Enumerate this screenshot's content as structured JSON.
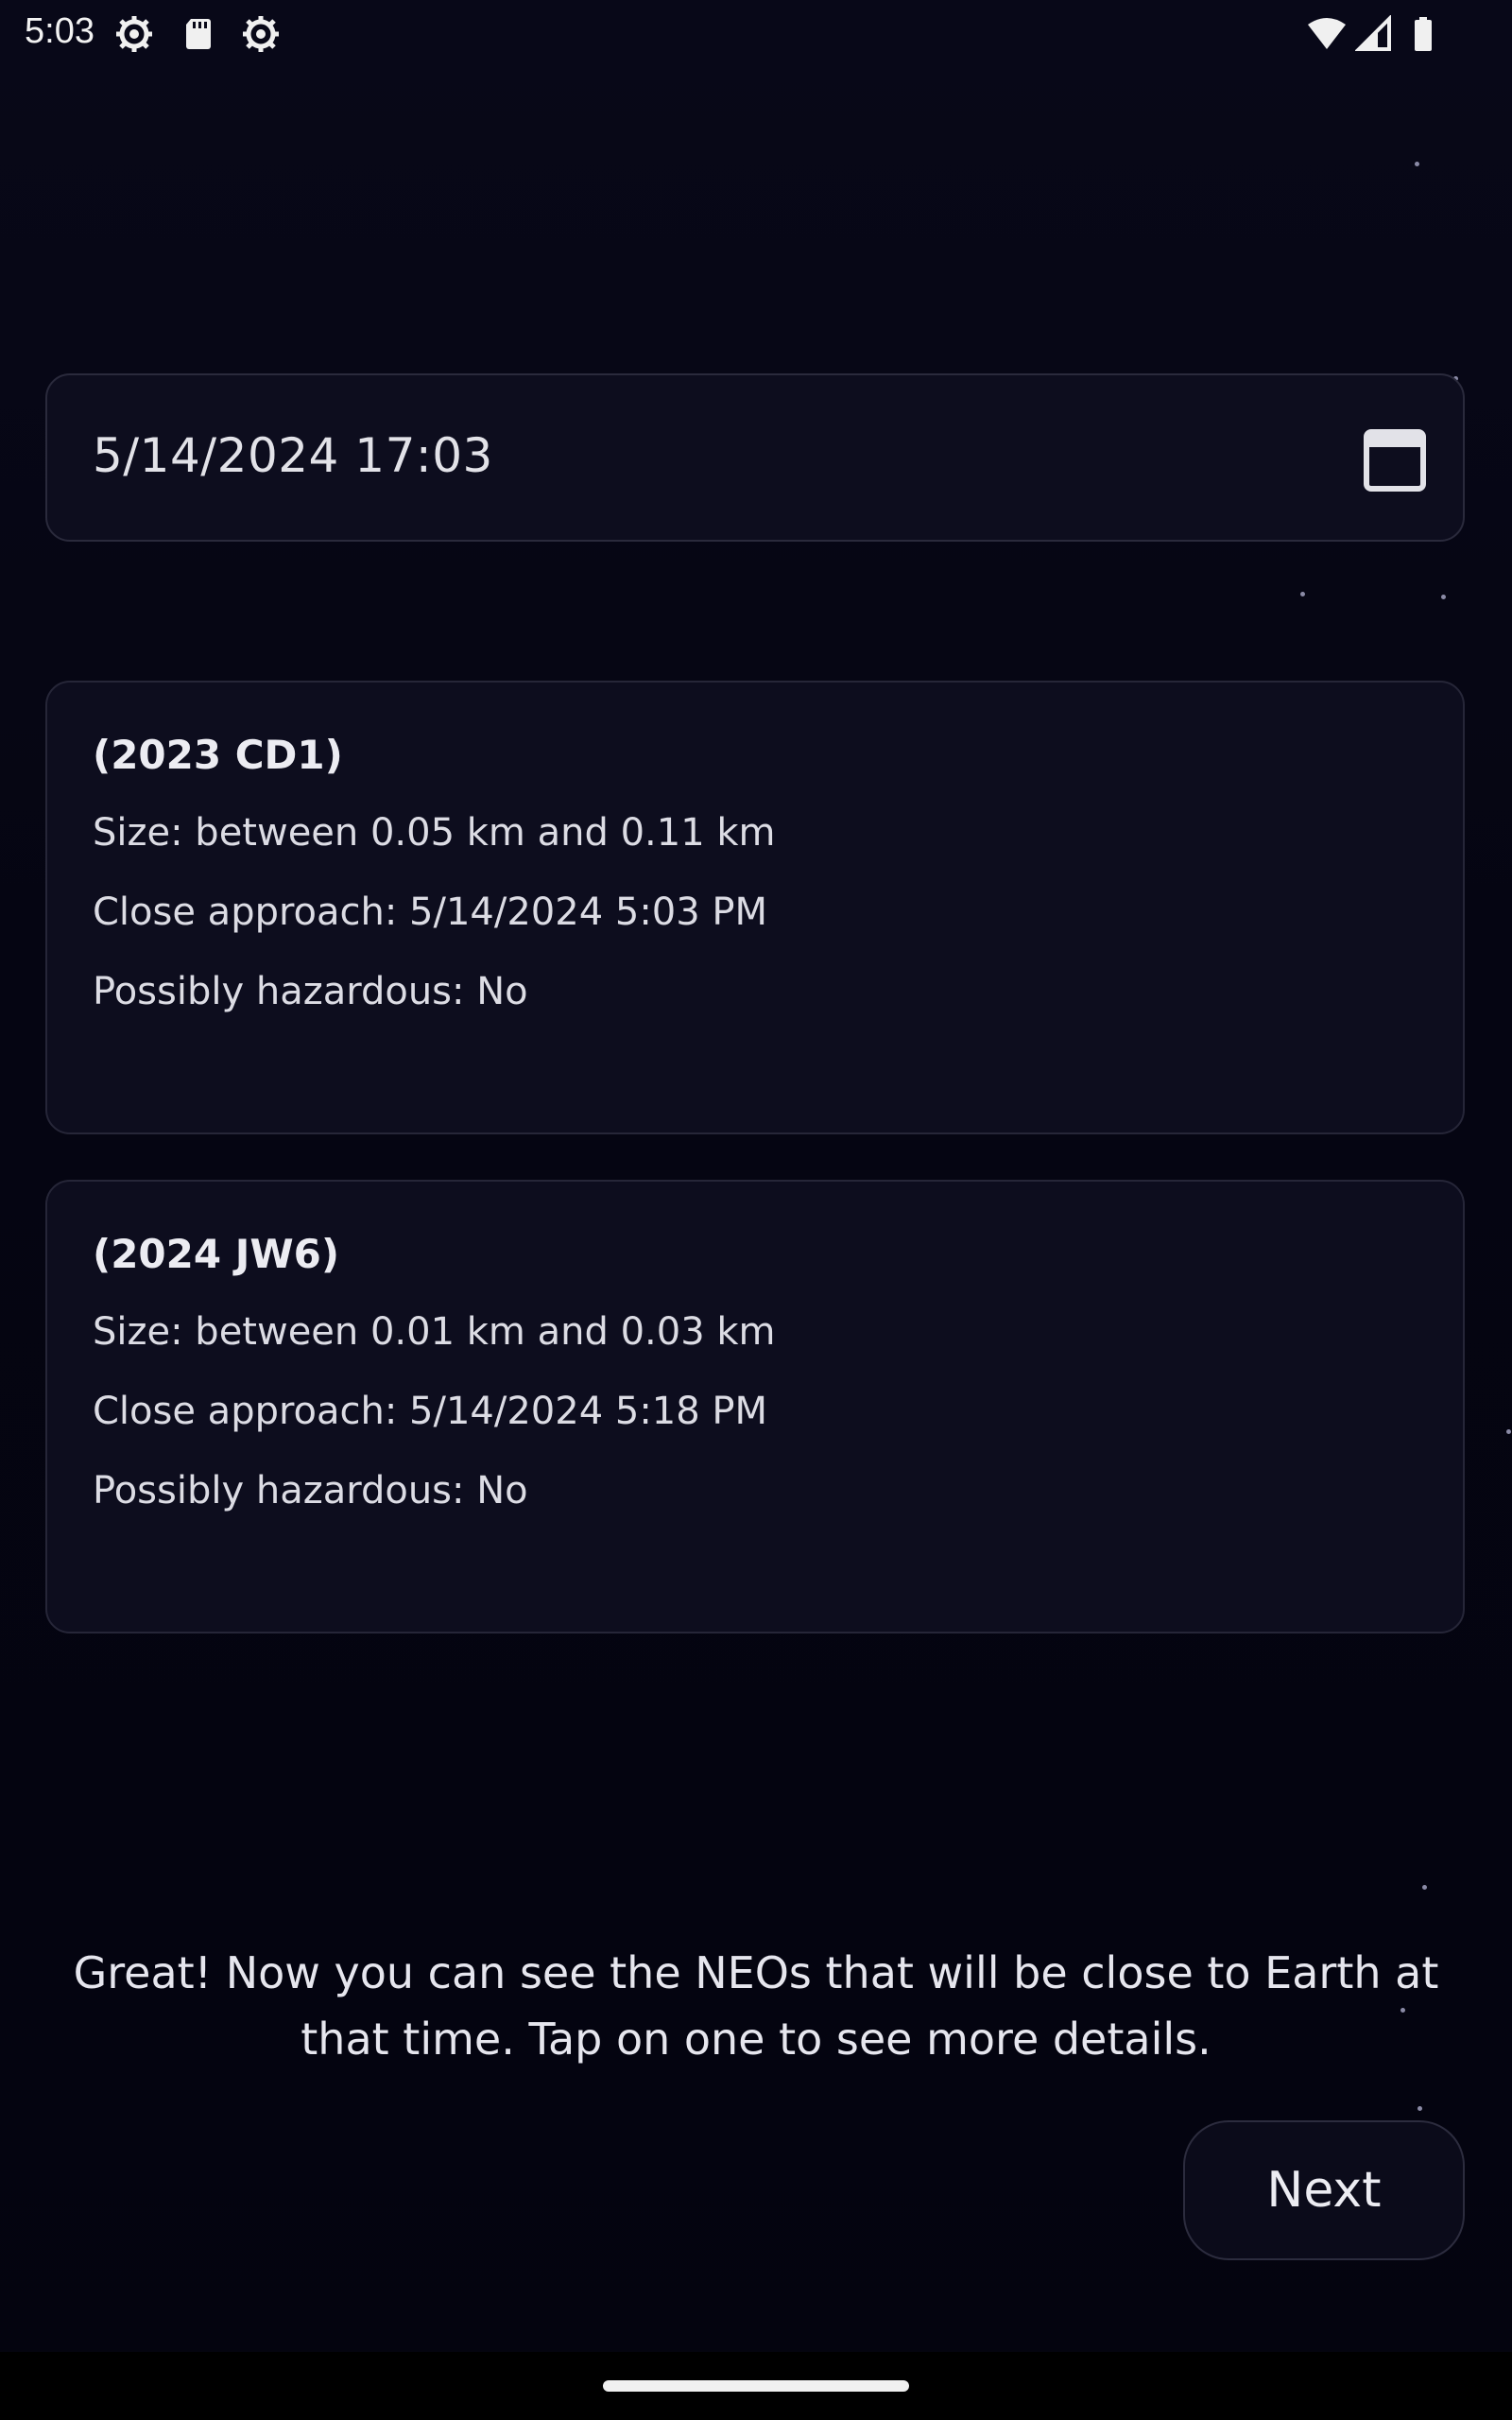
{
  "status_bar": {
    "time": "5:03",
    "left_icons": [
      "settings-gear-icon",
      "sd-card-icon",
      "settings-gear-icon"
    ],
    "right_icons": [
      "wifi-icon",
      "cell-signal-icon",
      "battery-icon"
    ]
  },
  "date_picker": {
    "value": "5/14/2024 17:03",
    "icon": "calendar-icon"
  },
  "neo_list": [
    {
      "name": "(2023 CD1)",
      "size": "Size: between 0.05 km and 0.11 km",
      "close_approach": "Close approach: 5/14/2024 5:03 PM",
      "hazardous": "Possibly hazardous: No"
    },
    {
      "name": "(2024 JW6)",
      "size": "Size: between 0.01 km and 0.03 km",
      "close_approach": "Close approach: 5/14/2024 5:18 PM",
      "hazardous": "Possibly hazardous: No"
    }
  ],
  "tutorial": {
    "message": "Great! Now you can see the NEOs that will be close to Earth at that time. Tap on one to see more details.",
    "next_label": "Next"
  },
  "colors": {
    "background": "#04040f",
    "card": "#0d0d1e",
    "card_border": "#262638",
    "text": "#e6e6ee"
  }
}
